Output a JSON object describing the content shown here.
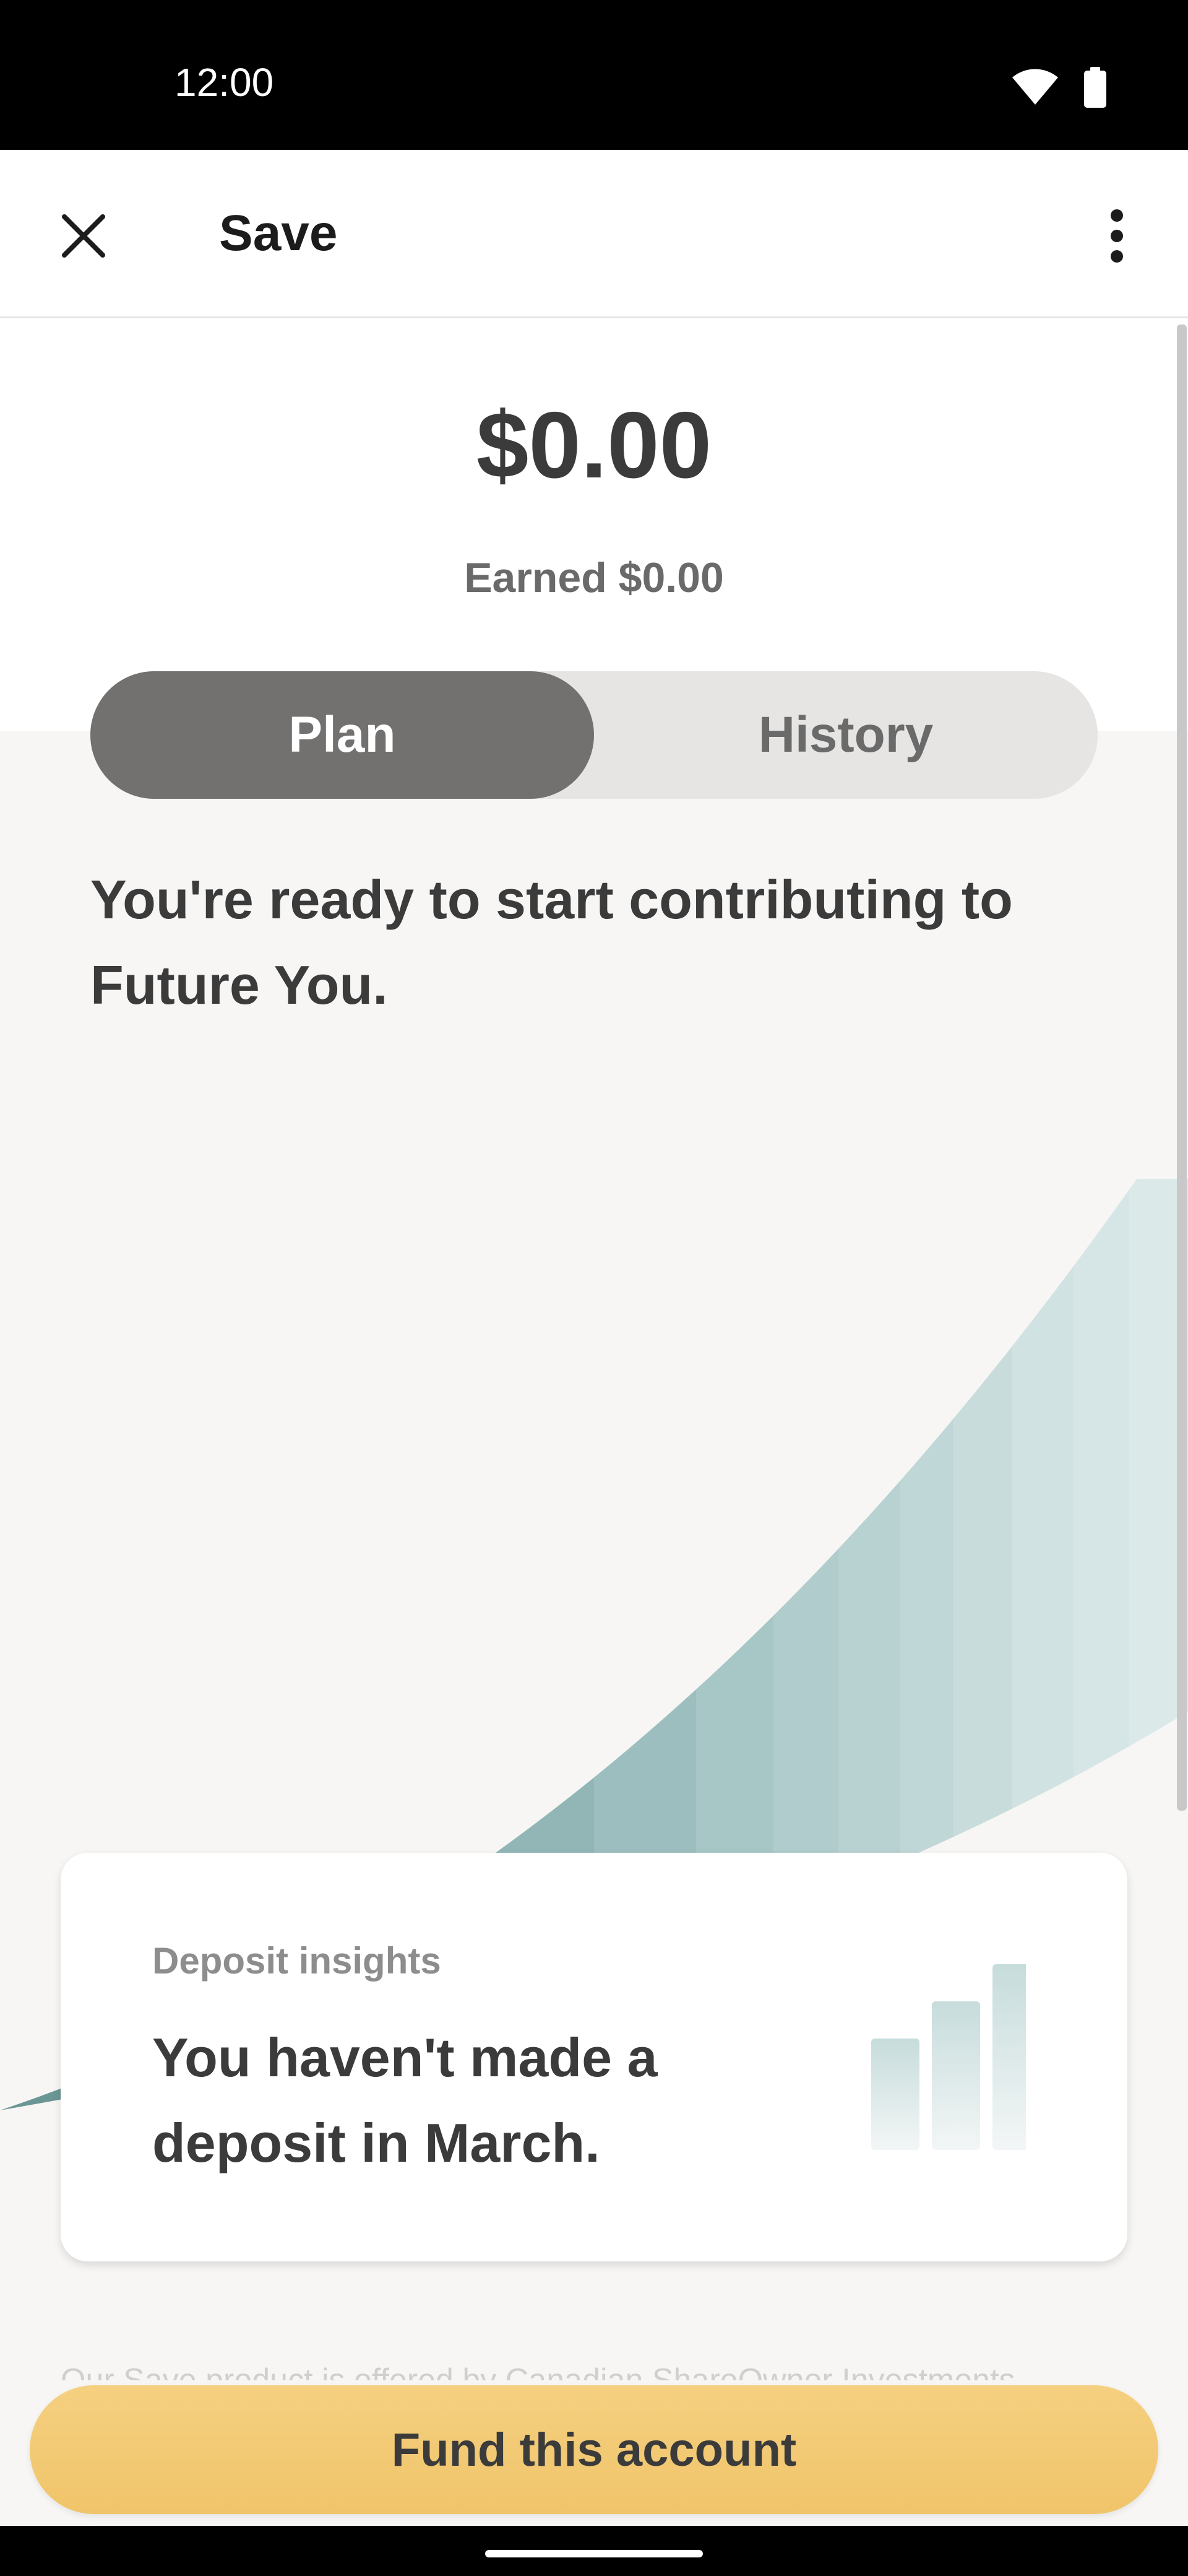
{
  "status_bar": {
    "time": "12:00",
    "icons": [
      "wifi-icon",
      "battery-icon"
    ]
  },
  "app_bar": {
    "title": "Save",
    "close_icon": "close-icon",
    "menu_icon": "more-vertical-icon"
  },
  "account": {
    "balance": "$0.00",
    "earned": "Earned $0.00"
  },
  "tabs": [
    {
      "label": "Plan",
      "selected": true
    },
    {
      "label": "History",
      "selected": false
    }
  ],
  "plan": {
    "message": "You're ready to start contributing to Future You."
  },
  "insights": {
    "label": "Deposit insights",
    "text": "You haven't made a deposit in March.",
    "icon": "bar-chart-icon"
  },
  "disclosure": "Our Save product is offered by Canadian ShareOwner Investments",
  "fund_button": {
    "label": "Fund this account"
  },
  "colors": {
    "accent": "#f0c46a",
    "growth_dark": "#6b9696",
    "growth_light": "#dbe9e9",
    "tab_selected": "#727170",
    "background": "#f7f6f4"
  }
}
